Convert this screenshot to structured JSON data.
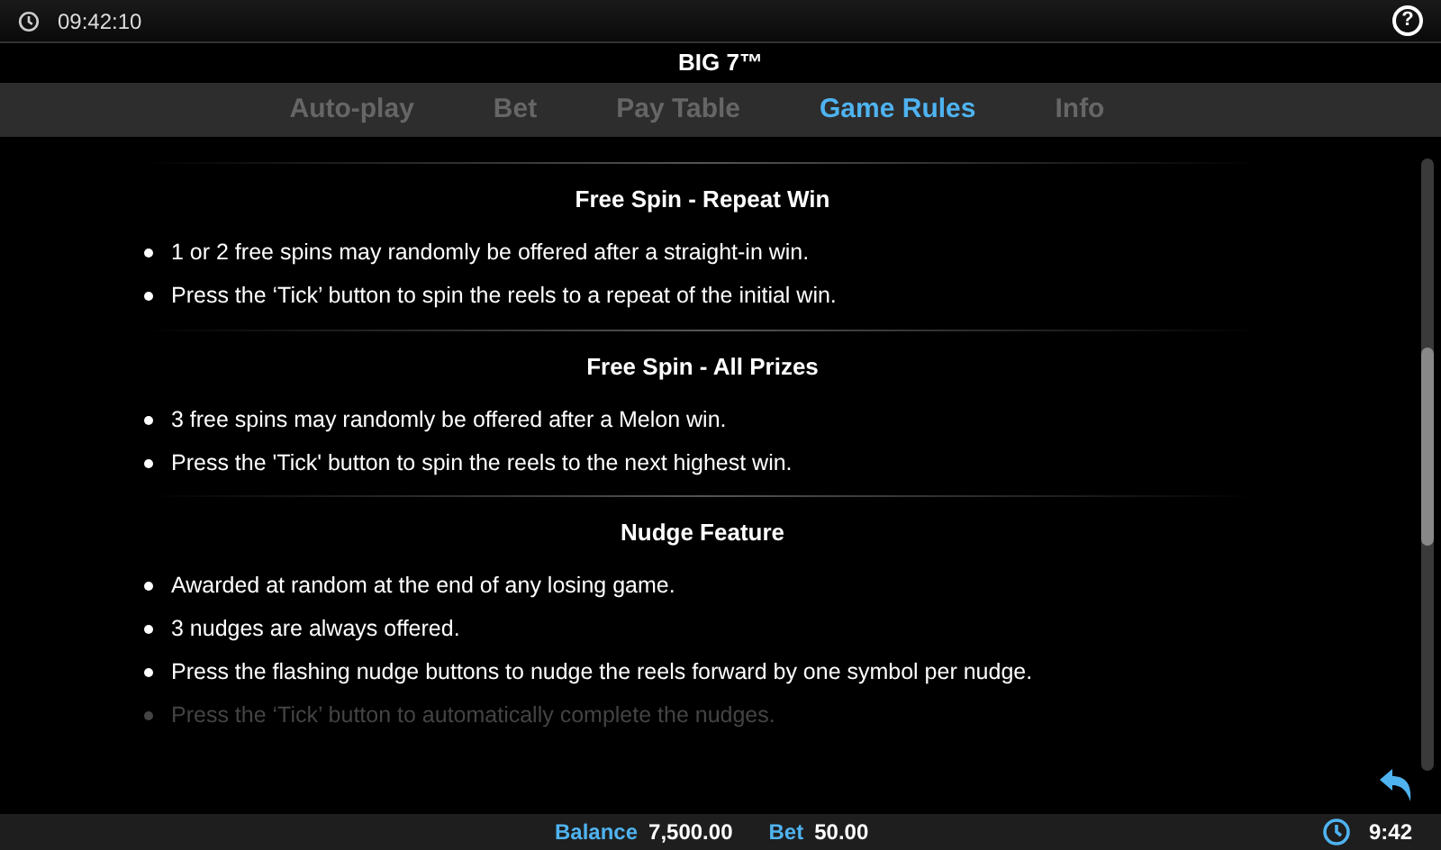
{
  "top_bar": {
    "time": "09:42:10",
    "help": "?"
  },
  "title": "BIG 7™",
  "tabs": [
    {
      "label": "Auto-play",
      "selected": false
    },
    {
      "label": "Bet",
      "selected": false
    },
    {
      "label": "Pay Table",
      "selected": false
    },
    {
      "label": "Game Rules",
      "selected": true
    },
    {
      "label": "Info",
      "selected": false
    }
  ],
  "sections": [
    {
      "heading": "Free Spin - Repeat Win",
      "bullets": [
        {
          "text": "1 or 2 free spins may randomly be offered after a straight-in win.",
          "faded": false
        },
        {
          "text": "Press the ‘Tick’ button to spin the reels to a repeat of the initial win.",
          "faded": false
        }
      ]
    },
    {
      "heading": "Free Spin - All Prizes",
      "bullets": [
        {
          "text": "3 free spins may randomly be offered after a Melon win.",
          "faded": false
        },
        {
          "text": "Press the 'Tick' button to spin the reels to the next highest win.",
          "faded": false
        }
      ]
    },
    {
      "heading": "Nudge Feature",
      "bullets": [
        {
          "text": "Awarded at random at the end of any losing game.",
          "faded": false
        },
        {
          "text": "3 nudges are always offered.",
          "faded": false
        },
        {
          "text": "Press the flashing nudge buttons to nudge the reels forward by one symbol per nudge.",
          "faded": false
        },
        {
          "text": "Press the ‘Tick’ button to automatically complete the nudges.",
          "faded": true
        }
      ]
    }
  ],
  "status_bar": {
    "balance_label": "Balance",
    "balance": "7,500.00",
    "bet_label": "Bet",
    "bet": "50.00",
    "time": "9:42"
  }
}
